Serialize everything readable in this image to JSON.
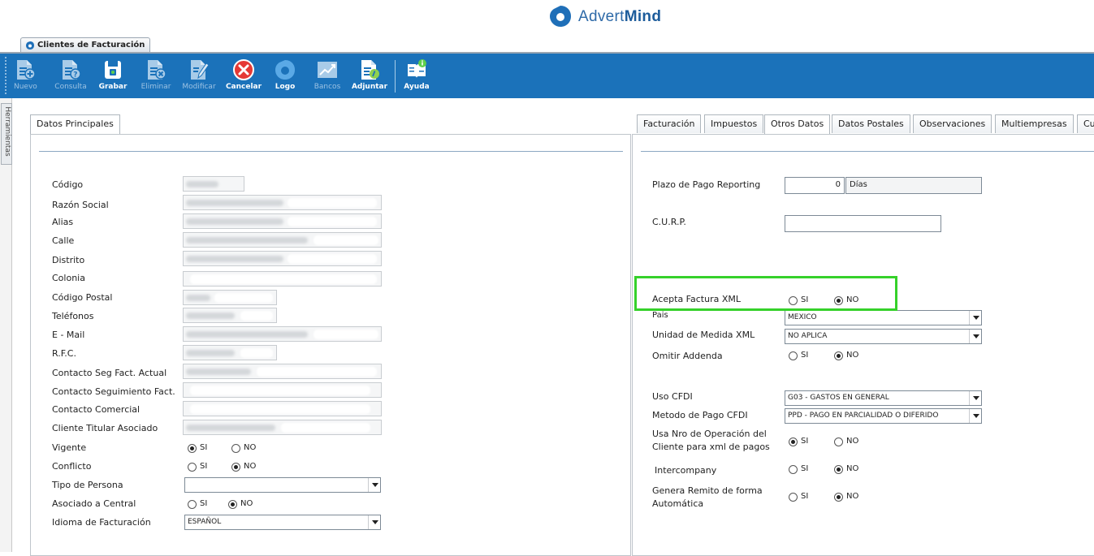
{
  "brand": {
    "prefix": "Advert",
    "suffix": "Mind"
  },
  "window_tab": {
    "title": "Clientes de Facturación"
  },
  "toolbar": {
    "buttons": [
      {
        "label": "Nuevo",
        "enabled": false
      },
      {
        "label": "Consulta",
        "enabled": false
      },
      {
        "label": "Grabar",
        "enabled": true
      },
      {
        "label": "Eliminar",
        "enabled": false
      },
      {
        "label": "Modificar",
        "enabled": false
      },
      {
        "label": "Cancelar",
        "enabled": true
      },
      {
        "label": "Logo",
        "enabled": true
      },
      {
        "label": "Bancos",
        "enabled": false
      },
      {
        "label": "Adjuntar",
        "enabled": true
      },
      {
        "label": "Ayuda",
        "enabled": true
      }
    ]
  },
  "side_tab": {
    "label": "Herramientas"
  },
  "left_panel": {
    "tab": "Datos Principales",
    "labels": {
      "codigo": "Código",
      "razon_social": "Razón Social",
      "alias": "Alias",
      "calle": "Calle",
      "distrito": "Distrito",
      "colonia": "Colonia",
      "codigo_postal": "Código Postal",
      "telefonos": "Teléfonos",
      "email": "E - Mail",
      "rfc": "R.F.C.",
      "contacto_seg_actual": "Contacto Seg Fact. Actual",
      "contacto_seguimiento": "Contacto Seguimiento Fact.",
      "contacto_comercial": "Contacto Comercial",
      "cliente_titular": "Cliente Titular Asociado",
      "vigente": "Vigente",
      "conflicto": "Conflicto",
      "tipo_persona": "Tipo de Persona",
      "asociado_central": "Asociado a Central",
      "idioma": "Idioma de Facturación"
    },
    "radio": {
      "si": "SI",
      "no": "NO"
    },
    "vigente": "SI",
    "conflicto": "NO",
    "asociado_central": "NO",
    "tipo_persona_value": "",
    "idioma_value": "ESPAÑOL"
  },
  "right_panel": {
    "tabs": [
      "Facturación",
      "Impuestos",
      "Otros Datos",
      "Datos Postales",
      "Observaciones",
      "Multiempresas",
      "Cu"
    ],
    "active_tab": "Otros Datos",
    "labels": {
      "plazo_pago": "Plazo de Pago Reporting",
      "curp": "C.U.R.P.",
      "acepta_xml": "Acepta Factura XML",
      "pais": "Pais",
      "unidad_medida": "Unidad de Medida XML",
      "omitir_addenda": "Omitir Addenda",
      "uso_cfdi": "Uso CFDI",
      "metodo_pago": "Metodo de Pago CFDI",
      "usa_nro_op_1": "Usa Nro de Operación del",
      "usa_nro_op_2": "Cliente para xml de pagos",
      "intercompany": "Intercompany",
      "genera_remito_1": "Genera Remito de forma",
      "genera_remito_2": "Automática"
    },
    "radio": {
      "si": "SI",
      "no": "NO"
    },
    "plazo_value": "0",
    "plazo_unit": "Días",
    "curp_value": "",
    "acepta_xml": "NO",
    "pais_value": "MEXICO",
    "unidad_medida_value": "NO APLICA",
    "omitir_addenda": "NO",
    "uso_cfdi_value": "G03 - GASTOS EN GENERAL",
    "metodo_pago_value": "PPD - PAGO EN PARCIALIDAD O DIFERIDO",
    "usa_nro_op": "SI",
    "intercompany": "NO",
    "genera_remito": "NO"
  },
  "colors": {
    "toolbar": "#1b72ba",
    "highlight": "#35d12a",
    "brand": "#2e6aa8"
  }
}
